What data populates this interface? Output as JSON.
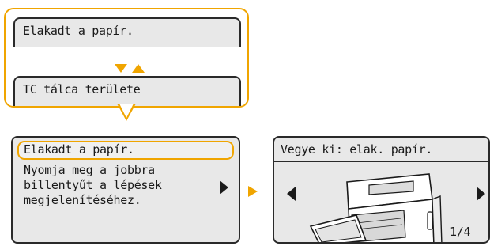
{
  "callout": {
    "top_label": "Elakadt a papír.",
    "bottom_label": "TC tálca területe"
  },
  "screen1": {
    "title": "Elakadt a papír.",
    "message_lines": [
      "Nyomja meg a jobbra",
      "billentyűt a lépések",
      "megjelenítéséhez."
    ]
  },
  "screen2": {
    "title": "Vegye ki: elak. papír.",
    "page_indicator": "1/4"
  },
  "colors": {
    "accent": "#f0a500",
    "lcd_bg": "#e8e8e8",
    "border": "#2a2a2a"
  },
  "icons": {
    "scroll_down": "triangle-down-icon",
    "scroll_up": "triangle-up-icon",
    "next": "triangle-right-icon",
    "prev": "triangle-left-icon"
  }
}
